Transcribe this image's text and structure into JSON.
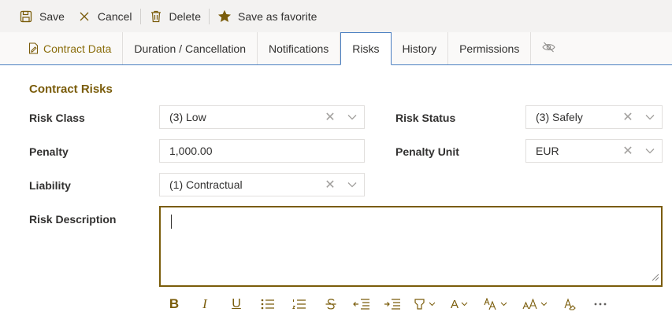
{
  "toolbar": {
    "save": "Save",
    "cancel": "Cancel",
    "delete": "Delete",
    "favorite": "Save as favorite"
  },
  "tabs": [
    {
      "label": "Contract Data"
    },
    {
      "label": "Duration / Cancellation"
    },
    {
      "label": "Notifications"
    },
    {
      "label": "Risks"
    },
    {
      "label": "History"
    },
    {
      "label": "Permissions"
    }
  ],
  "active_tab": "Risks",
  "section": {
    "title": "Contract Risks"
  },
  "fields": {
    "risk_class": {
      "label": "Risk Class",
      "value": "(3) Low"
    },
    "risk_status": {
      "label": "Risk Status",
      "value": "(3) Safely"
    },
    "penalty": {
      "label": "Penalty",
      "value": "1,000.00"
    },
    "penalty_unit": {
      "label": "Penalty Unit",
      "value": "EUR"
    },
    "liability": {
      "label": "Liability",
      "value": "(1) Contractual"
    },
    "risk_description": {
      "label": "Risk Description",
      "value": ""
    }
  },
  "editor_toolbar": {
    "bold": "B",
    "italic": "I",
    "underline": "U",
    "font_color": "A"
  },
  "colors": {
    "accent": "#7a5c0a",
    "tab_border": "#4a7fc1",
    "toolbar_bg": "#f3f2f1"
  }
}
